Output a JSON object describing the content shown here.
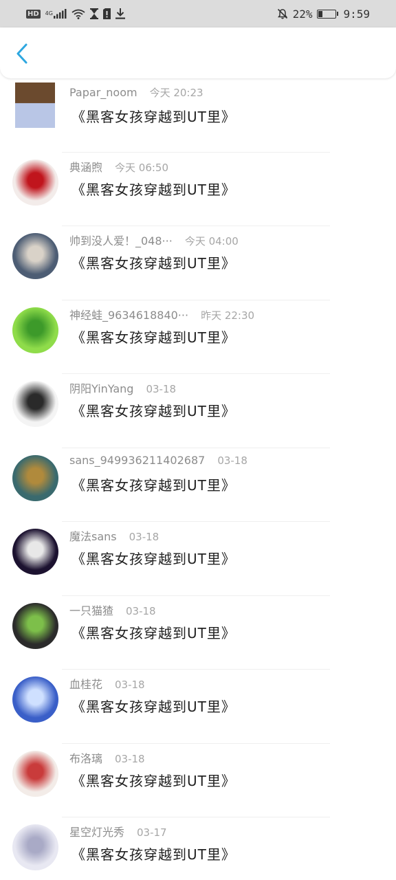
{
  "status_bar": {
    "left_icons": [
      "hd-badge",
      "signal-4g",
      "wifi-icon",
      "hourglass-icon",
      "sim-icon",
      "download-icon"
    ],
    "hd_label": "HD",
    "network_label": "4G",
    "battery_percent_label": "22%",
    "battery_level": 0.22,
    "time": "9:59"
  },
  "nav": {
    "back_icon": "chevron-left-icon",
    "accent": "#2ea7e0"
  },
  "comments": [
    {
      "user": "Papar_noom",
      "time": "今天 20:23",
      "text": "《黑客女孩穿越到UT里》",
      "avatar_colors": [
        "#6b4a2e",
        "#b9c6e6"
      ]
    },
    {
      "user": "典涵煦",
      "time": "今天 06:50",
      "text": "《黑客女孩穿越到UT里》",
      "avatar_colors": [
        "#f3ecea",
        "#c0151d"
      ]
    },
    {
      "user": "帅到没人爱！_048···",
      "time": "今天 04:00",
      "text": "《黑客女孩穿越到UT里》",
      "avatar_colors": [
        "#4d5d74",
        "#d9d2c8"
      ]
    },
    {
      "user": "神经蛙_9634618840···",
      "time": "昨天 22:30",
      "text": "《黑客女孩穿越到UT里》",
      "avatar_colors": [
        "#8fdc4a",
        "#3d9a2a"
      ]
    },
    {
      "user": "阴阳YinYang",
      "time": "03-18",
      "text": "《黑客女孩穿越到UT里》",
      "avatar_colors": [
        "#f4f4f4",
        "#2a2a2a"
      ]
    },
    {
      "user": "sans_949936211402687",
      "time": "03-18",
      "text": "《黑客女孩穿越到UT里》",
      "avatar_colors": [
        "#3a6a6e",
        "#b08a3c"
      ]
    },
    {
      "user": "魔法sans",
      "time": "03-18",
      "text": "《黑客女孩穿越到UT里》",
      "avatar_colors": [
        "#1c1230",
        "#e8e8e8"
      ]
    },
    {
      "user": "一只猫猹",
      "time": "03-18",
      "text": "《黑客女孩穿越到UT里》",
      "avatar_colors": [
        "#2b2b2b",
        "#7dbf4a"
      ]
    },
    {
      "user": "血桂花",
      "time": "03-18",
      "text": "《黑客女孩穿越到UT里》",
      "avatar_colors": [
        "#3a5fc8",
        "#cfe0ff"
      ]
    },
    {
      "user": "布洛璃",
      "time": "03-18",
      "text": "《黑客女孩穿越到UT里》",
      "avatar_colors": [
        "#f3ece8",
        "#c93b3b"
      ]
    },
    {
      "user": "星空灯光秀",
      "time": "03-17",
      "text": "《黑客女孩穿越到UT里》",
      "avatar_colors": [
        "#e8e8f2",
        "#a9aac6"
      ]
    }
  ]
}
